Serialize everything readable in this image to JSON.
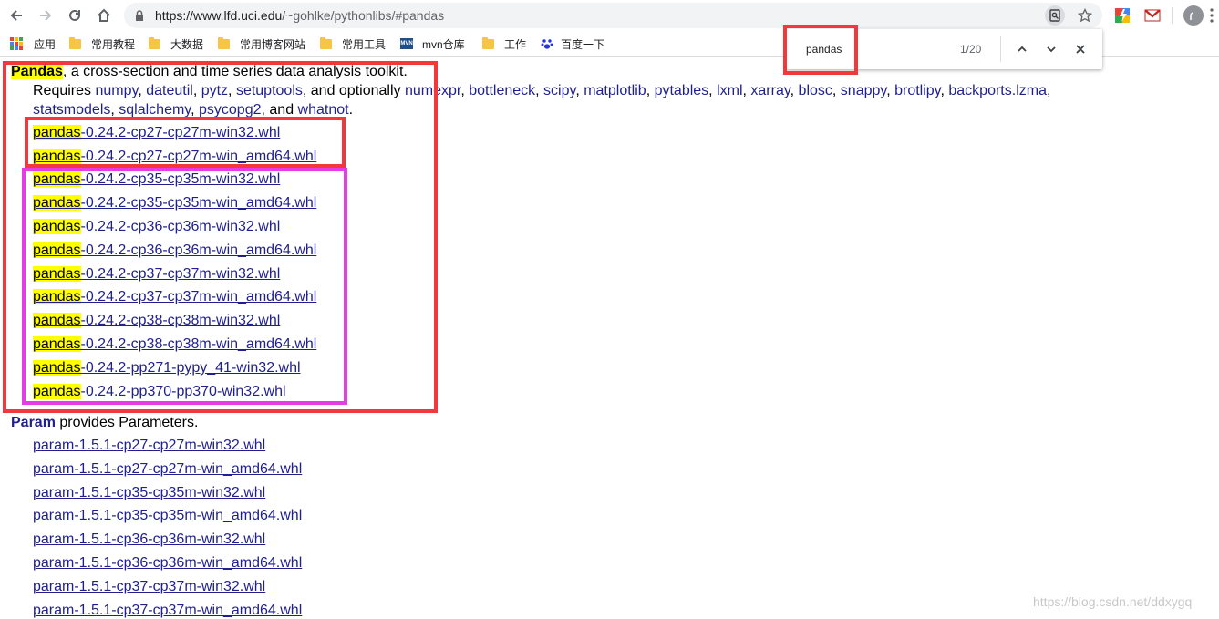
{
  "browser": {
    "url_host": "https://www.lfd.uci.edu",
    "url_path": "/~gohlke/pythonlibs/#pandas"
  },
  "bookmarks": [
    {
      "label": "应用",
      "icon": "apps-grid-icon"
    },
    {
      "label": "常用教程",
      "icon": "folder-icon"
    },
    {
      "label": "大数据",
      "icon": "folder-icon"
    },
    {
      "label": "常用博客网站",
      "icon": "folder-icon"
    },
    {
      "label": "常用工具",
      "icon": "folder-icon"
    },
    {
      "label": "mvn仓库",
      "icon": "mvn-icon"
    },
    {
      "label": "工作",
      "icon": "folder-icon"
    },
    {
      "label": "百度一下",
      "icon": "baidu-paw-icon"
    }
  ],
  "findbar": {
    "query": "pandas",
    "count": "1/20"
  },
  "pandas": {
    "name": "Pandas",
    "description": ", a cross-section and time series data analysis toolkit.",
    "requires_prefix": "Requires ",
    "deps_line1": [
      "numpy",
      "dateutil",
      "pytz",
      "setuptools"
    ],
    "optionally": ", and optionally ",
    "deps_line1b": [
      "numexpr",
      "bottleneck",
      "scipy",
      "matplotlib",
      "pytables",
      "lxml",
      "xarray",
      "blosc",
      "snappy",
      "brotlipy",
      "backports.lzma"
    ],
    "deps_line2": [
      "statsmodels",
      "sqlalchemy",
      "psycopg2"
    ],
    "and_text": ", and ",
    "deps_last": "whatnot",
    "period": ".",
    "files": [
      {
        "prefix": "pandas",
        "rest": "-0.24.2-cp27-cp27m-win32.whl"
      },
      {
        "prefix": "pandas",
        "rest": "-0.24.2-cp27-cp27m-win_amd64.whl"
      },
      {
        "prefix": "pandas",
        "rest": "-0.24.2-cp35-cp35m-win32.whl"
      },
      {
        "prefix": "pandas",
        "rest": "-0.24.2-cp35-cp35m-win_amd64.whl"
      },
      {
        "prefix": "pandas",
        "rest": "-0.24.2-cp36-cp36m-win32.whl"
      },
      {
        "prefix": "pandas",
        "rest": "-0.24.2-cp36-cp36m-win_amd64.whl"
      },
      {
        "prefix": "pandas",
        "rest": "-0.24.2-cp37-cp37m-win32.whl"
      },
      {
        "prefix": "pandas",
        "rest": "-0.24.2-cp37-cp37m-win_amd64.whl"
      },
      {
        "prefix": "pandas",
        "rest": "-0.24.2-cp38-cp38m-win32.whl"
      },
      {
        "prefix": "pandas",
        "rest": "-0.24.2-cp38-cp38m-win_amd64.whl"
      },
      {
        "prefix": "pandas",
        "rest": "-0.24.2-pp271-pypy_41-win32.whl"
      },
      {
        "prefix": "pandas",
        "rest": "-0.24.2-pp370-pp370-win32.whl"
      }
    ]
  },
  "param": {
    "name": "Param",
    "description": " provides Parameters.",
    "files": [
      "param-1.5.1-cp27-cp27m-win32.whl",
      "param-1.5.1-cp27-cp27m-win_amd64.whl",
      "param-1.5.1-cp35-cp35m-win32.whl",
      "param-1.5.1-cp35-cp35m-win_amd64.whl",
      "param-1.5.1-cp36-cp36m-win32.whl",
      "param-1.5.1-cp36-cp36m-win_amd64.whl",
      "param-1.5.1-cp37-cp37m-win32.whl",
      "param-1.5.1-cp37-cp37m-win_amd64.whl"
    ]
  },
  "watermark": "https://blog.csdn.net/ddxygq"
}
